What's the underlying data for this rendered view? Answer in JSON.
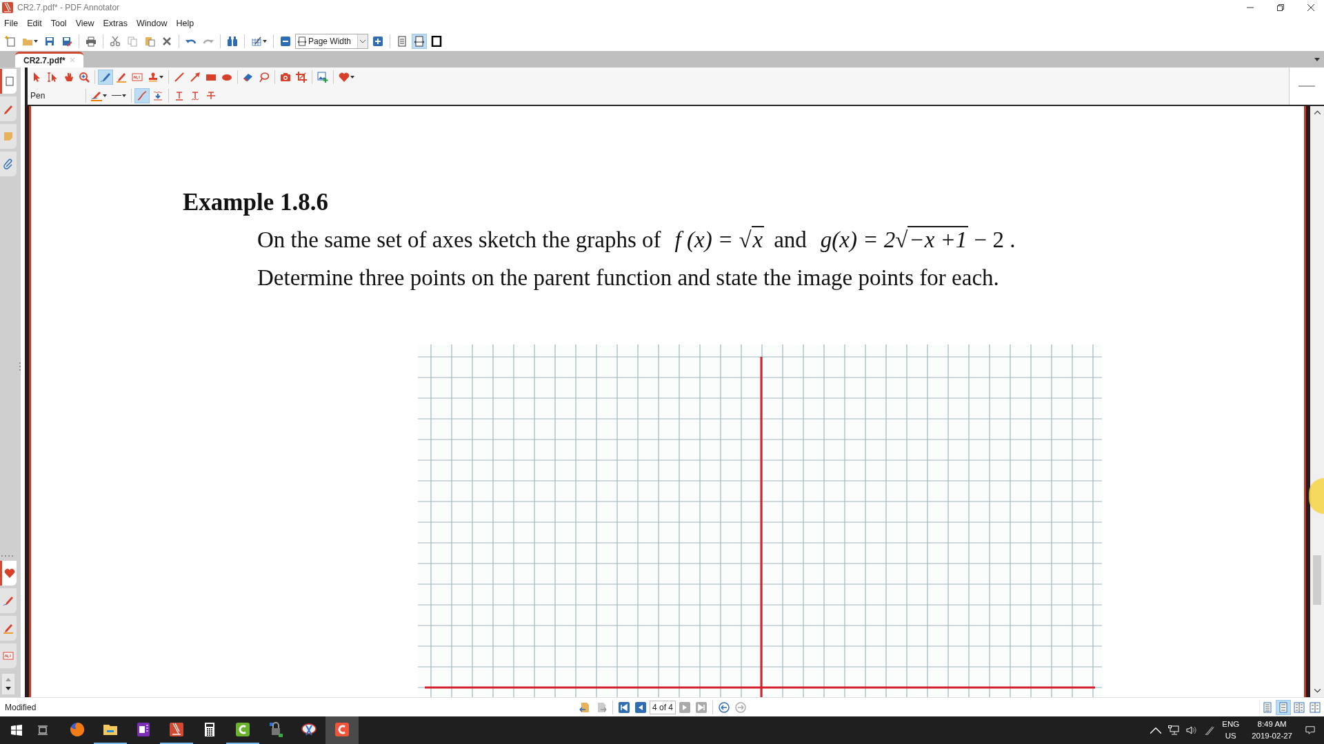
{
  "window": {
    "title": "CR2.7.pdf* - PDF Annotator"
  },
  "menu": [
    "File",
    "Edit",
    "Tool",
    "View",
    "Extras",
    "Window",
    "Help"
  ],
  "toolbar": {
    "zoom_mode": "Page Width",
    "fit_buttons": [
      {
        "selected": false
      },
      {
        "selected": true
      },
      {
        "selected": false
      }
    ]
  },
  "document_tab": {
    "label": "CR2.7.pdf*"
  },
  "tools": [
    {
      "selected": false
    },
    {
      "selected": false
    },
    {
      "selected": false
    },
    {
      "selected": false
    },
    {
      "selected": true
    },
    {
      "selected": false
    },
    {
      "selected": false
    },
    {
      "selected": false
    },
    {
      "selected": false
    },
    {
      "selected": false
    },
    {
      "selected": false
    },
    {
      "selected": false
    },
    {
      "selected": false
    },
    {
      "selected": false
    },
    {
      "selected": false
    },
    {
      "selected": false
    },
    {
      "selected": false
    },
    {
      "selected": false
    }
  ],
  "tool_options": {
    "label": "Pen",
    "stroke_options": [
      {
        "selected": true
      },
      {
        "selected": false
      }
    ]
  },
  "sidebar_tabs": [
    {
      "selected": true
    },
    {
      "selected": false
    },
    {
      "selected": false
    },
    {
      "selected": false
    }
  ],
  "favorites_tabs": [
    {
      "selected": true
    },
    {
      "selected": false
    },
    {
      "selected": false
    },
    {
      "selected": false
    }
  ],
  "page": {
    "heading": "Example 1.8.6",
    "intro": "On the same set of axes sketch the graphs of",
    "formula_f": {
      "lhs": "f (x) =",
      "radical": "√",
      "radicand": "x"
    },
    "connector": "and",
    "formula_g": {
      "lhs": "g(x) = 2",
      "radical": "√",
      "radicand": "−x +1",
      "rhs": "− 2 ."
    },
    "line_2": "Determine three points on the parent function and state the image points for each."
  },
  "status_bar": {
    "status": "Modified",
    "page_indicator": "4 of 4",
    "layouts": [
      {
        "selected": false
      },
      {
        "selected": true
      },
      {
        "selected": false
      },
      {
        "selected": false
      }
    ]
  },
  "taskbar": {
    "apps": [
      {
        "running": false,
        "active": false
      },
      {
        "running": true,
        "active": false
      },
      {
        "running": false,
        "active": false
      },
      {
        "running": true,
        "active": false
      },
      {
        "running": false,
        "active": false
      },
      {
        "running": true,
        "active": false
      },
      {
        "running": false,
        "active": false
      },
      {
        "running": false,
        "active": false
      },
      {
        "running": false,
        "active": true
      }
    ],
    "tray": {
      "language": "ENG",
      "region": "US",
      "time": "8:49 AM",
      "date": "2019-02-27"
    }
  }
}
